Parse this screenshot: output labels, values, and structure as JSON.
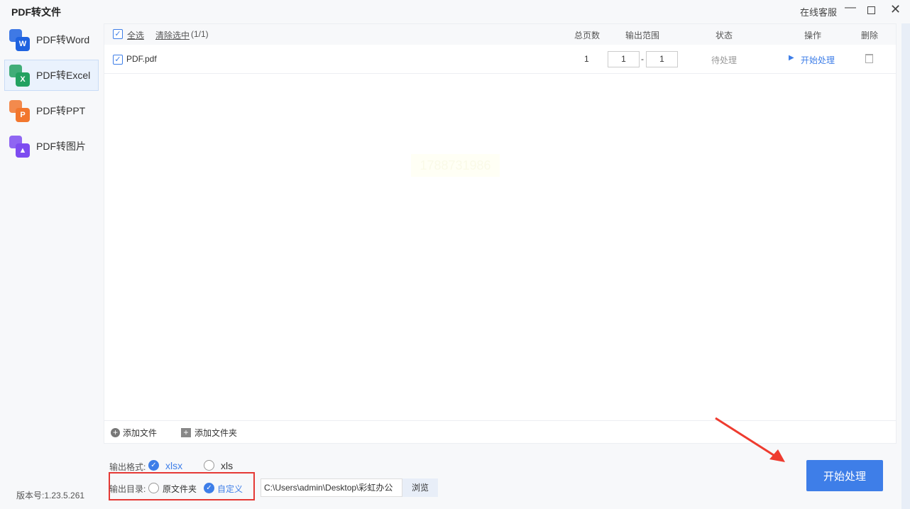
{
  "app": {
    "title": "PDF转文件",
    "support": "在线客服",
    "version": "版本号:1.23.5.261"
  },
  "sidebar": {
    "items": [
      {
        "label": "PDF转Word",
        "letter": "W",
        "color": "#1f63e0",
        "active": false
      },
      {
        "label": "PDF转Excel",
        "letter": "X",
        "color": "#23a160",
        "active": true
      },
      {
        "label": "PDF转PPT",
        "letter": "P",
        "color": "#f2772e",
        "active": false
      },
      {
        "label": "PDF转图片",
        "letter": "",
        "color": "#7d4cf0",
        "active": false
      }
    ]
  },
  "table": {
    "select_all": "全选",
    "clear_selection": "清除选中",
    "count": "(1/1)",
    "columns": [
      "总页数",
      "输出范围",
      "状态",
      "操作",
      "删除"
    ],
    "rows": [
      {
        "name": "PDF.pdf",
        "pages": "1",
        "from": "1",
        "sep": "-",
        "to": "1",
        "status": "待处理",
        "action": "开始处理",
        "checked": true
      }
    ],
    "watermark": "1788731986"
  },
  "footer": {
    "add_file": "添加文件",
    "add_folder": "添加文件夹"
  },
  "options": {
    "format_label": "输出格式:",
    "formats": [
      {
        "label": "xlsx",
        "selected": true
      },
      {
        "label": "xls",
        "selected": false
      }
    ],
    "dir_label": "输出目录:",
    "dirs": [
      {
        "label": "原文件夹",
        "selected": false
      },
      {
        "label": "自定义",
        "selected": true
      }
    ],
    "path": "C:\\Users\\admin\\Desktop\\彩虹办公",
    "browse": "浏览"
  },
  "start_button": "开始处理",
  "colors": {
    "accent": "#3e7ee8",
    "highlight_box": "#e53935",
    "arrow": "#ee3b2f"
  }
}
